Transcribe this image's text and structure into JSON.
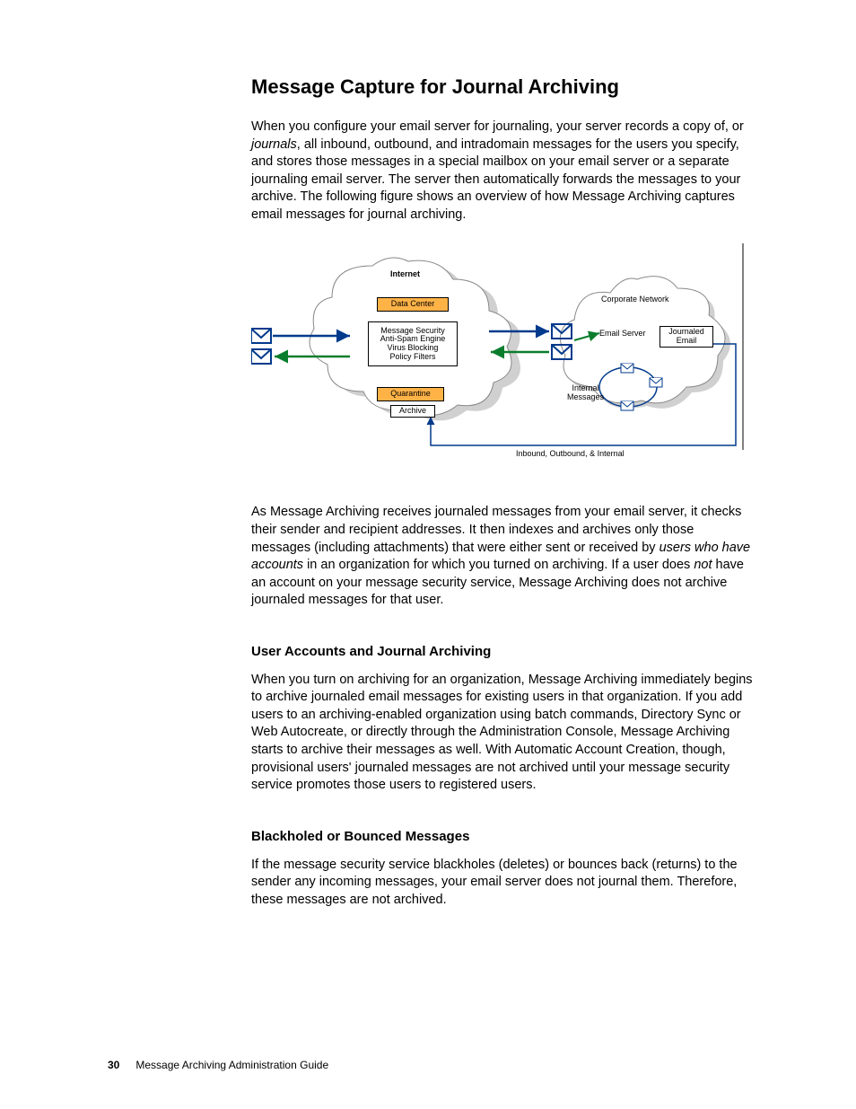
{
  "heading": "Message Capture for Journal Archiving",
  "para1a": "When you configure your email server for journaling, your server records a copy of, or ",
  "para1b": "journals",
  "para1c": ", all inbound, outbound, and intradomain messages for the users you specify, and stores those messages in a special mailbox on your email server or a separate journaling email server. The server then automatically forwards the messages to your archive. The following figure shows an overview of how Message Archiving captures email messages for journal archiving.",
  "para2a": "As Message Archiving receives journaled messages from your email server, it checks their sender and recipient addresses. It then indexes and archives only those messages (including attachments) that were either sent or received by ",
  "para2b": "users who have accounts",
  "para2c": " in an organization for which you turned on archiving. If a user does ",
  "para2d": "not",
  "para2e": " have an account on your message security service, Message Archiving does not archive journaled messages for that user.",
  "sub1": "User Accounts and Journal Archiving",
  "para3": "When you turn on archiving for an organization, Message Archiving immediately begins to archive journaled email messages for existing users in that organization. If you add users to an archiving-enabled organization using batch commands, Directory Sync or Web Autocreate, or directly through the Administration Console, Message Archiving starts to archive their messages as well. With Automatic Account Creation, though, provisional users' journaled messages are not archived until your message security service promotes those users to registered users.",
  "sub2": "Blackholed or Bounced Messages",
  "para4": "If the message security service blackholes (deletes) or bounces back (returns) to the sender any incoming messages, your email server does not journal them. Therefore, these messages are not archived.",
  "footer_page": "30",
  "footer_text": "Message Archiving Administration Guide",
  "fig": {
    "internet": "Internet",
    "data_center": "Data Center",
    "security": "Message Security\nAnti-Spam Engine\nVirus Blocking\nPolicy Filters",
    "quarantine": "Quarantine",
    "archive": "Archive",
    "corp_net": "Corporate Network",
    "email_server": "Email Server",
    "journaled": "Journaled\nEmail",
    "internal": "Internal\nMessages",
    "caption": "Inbound, Outbound, & Internal"
  }
}
